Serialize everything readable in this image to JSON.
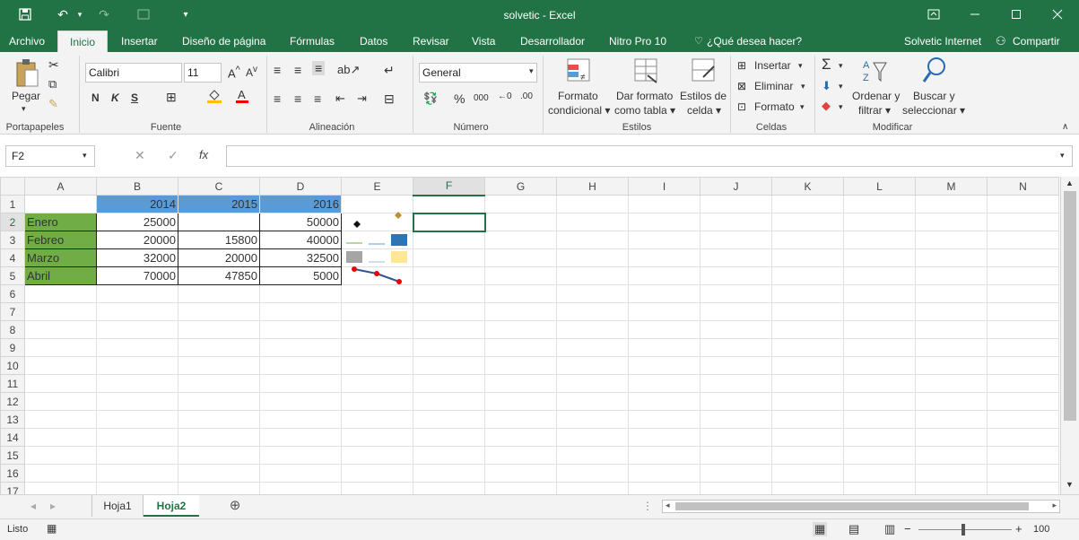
{
  "app": {
    "title": "solvetic - Excel"
  },
  "qat": {
    "undo": "↶",
    "dropdown": "▾"
  },
  "tabs": [
    {
      "label": "Archivo"
    },
    {
      "label": "Inicio"
    },
    {
      "label": "Insertar"
    },
    {
      "label": "Diseño de página"
    },
    {
      "label": "Fórmulas"
    },
    {
      "label": "Datos"
    },
    {
      "label": "Revisar"
    },
    {
      "label": "Vista"
    },
    {
      "label": "Desarrollador"
    },
    {
      "label": "Nitro Pro 10"
    }
  ],
  "tellme": "¿Qué desea hacer?",
  "account": "Solvetic Internet",
  "share": "Compartir",
  "ribbon": {
    "paste": "Pegar",
    "font_name": "Calibri",
    "font_size": "11",
    "bold": "N",
    "italic": "K",
    "underline": "S",
    "number_format": "General",
    "cond_format": [
      "Formato",
      "condicional ▾"
    ],
    "table_format": [
      "Dar formato",
      "como tabla ▾"
    ],
    "cell_styles": [
      "Estilos de",
      "celda ▾"
    ],
    "insert": "Insertar",
    "delete": "Eliminar",
    "format": "Formato",
    "sort": [
      "Ordenar y",
      "filtrar ▾"
    ],
    "find": [
      "Buscar y",
      "seleccionar ▾"
    ],
    "groups": [
      "Portapapeles",
      "Fuente",
      "Alineación",
      "Número",
      "Estilos",
      "Celdas",
      "Modificar"
    ]
  },
  "formula": {
    "namebox": "F2",
    "fx": "fx",
    "content": ""
  },
  "columns": [
    "A",
    "B",
    "C",
    "D",
    "E",
    "F",
    "G",
    "H",
    "I",
    "J",
    "K",
    "L",
    "M",
    "N"
  ],
  "rows": [
    [
      "",
      "2014",
      "2015",
      "2016"
    ],
    [
      "Enero",
      "25000",
      "",
      "50000"
    ],
    [
      "Febreo",
      "20000",
      "15800",
      "40000"
    ],
    [
      "Marzo",
      "32000",
      "20000",
      "32500"
    ],
    [
      "Abril",
      "70000",
      "47850",
      "5000"
    ]
  ],
  "row_numbers": [
    "1",
    "2",
    "3",
    "4",
    "5",
    "6",
    "7",
    "8",
    "9",
    "10",
    "11",
    "12",
    "13",
    "14",
    "15",
    "16",
    "17"
  ],
  "sheets": [
    {
      "label": "Hoja1"
    },
    {
      "label": "Hoja2"
    }
  ],
  "status": {
    "ready": "Listo",
    "zoom": "100"
  },
  "colors": {
    "excel_green": "#217346",
    "header_blue": "#5b9bd5",
    "label_green": "#70ad47"
  }
}
